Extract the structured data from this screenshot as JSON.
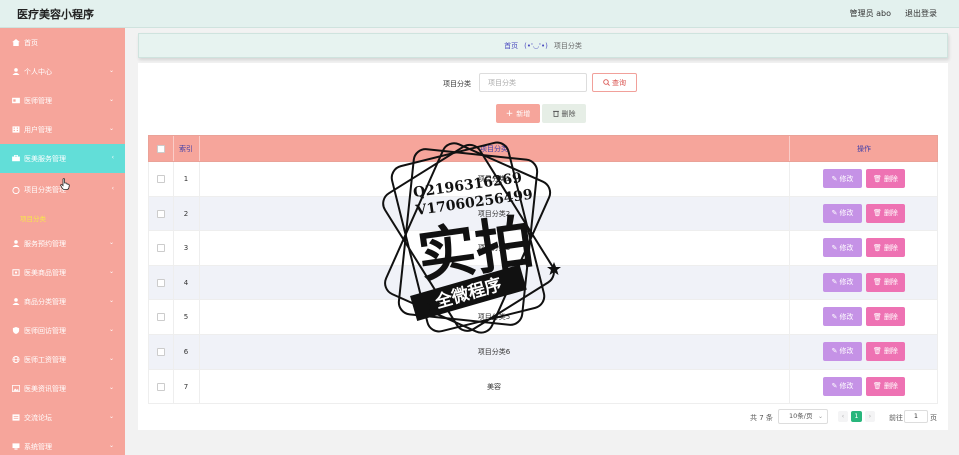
{
  "app": {
    "title": "医疗美容小程序"
  },
  "topbar": {
    "user": "管理员 abo",
    "logout": "退出登录"
  },
  "sidebar": {
    "items": [
      {
        "label": "首页",
        "icon": "home-icon",
        "chev": ""
      },
      {
        "label": "个人中心",
        "icon": "user-icon",
        "chev": "⌄"
      },
      {
        "label": "医师管理",
        "icon": "id-card-icon",
        "chev": "⌄"
      },
      {
        "label": "用户管理",
        "icon": "building-icon",
        "chev": "⌄"
      },
      {
        "label": "医美服务管理",
        "icon": "service-icon",
        "chev": "‹"
      },
      {
        "label": "项目分类管理",
        "icon": "chat-icon",
        "chev": "‹"
      },
      {
        "label": "服务预约管理",
        "icon": "user-icon",
        "chev": "⌄"
      },
      {
        "label": "医美商品管理",
        "icon": "goods-icon",
        "chev": "⌄"
      },
      {
        "label": "商品分类管理",
        "icon": "user-icon",
        "chev": "⌄"
      },
      {
        "label": "医师回访管理",
        "icon": "shield-icon",
        "chev": "⌄"
      },
      {
        "label": "医师工资管理",
        "icon": "globe-icon",
        "chev": "⌄"
      },
      {
        "label": "医美资讯管理",
        "icon": "image-icon",
        "chev": "⌄"
      },
      {
        "label": "交流论坛",
        "icon": "forum-icon",
        "chev": "⌄"
      },
      {
        "label": "系统管理",
        "icon": "system-icon",
        "chev": "⌄"
      }
    ],
    "submenu": {
      "label": "项目分类"
    }
  },
  "breadcrumb": {
    "home": "首页",
    "emoticon": "(•'◡'•)",
    "current": "项目分类"
  },
  "search": {
    "label": "项目分类",
    "placeholder": "项目分类",
    "query_label": "查询"
  },
  "toolbar": {
    "add_label": "新增",
    "delete_label": "删除"
  },
  "table": {
    "headers": {
      "index": "索引",
      "name": "项目分类",
      "ops": "操作"
    },
    "rows": [
      {
        "index": "1",
        "name": "项目分类1"
      },
      {
        "index": "2",
        "name": "项目分类2"
      },
      {
        "index": "3",
        "name": "项目分类3"
      },
      {
        "index": "4",
        "name": "项目分类4"
      },
      {
        "index": "5",
        "name": "项目分类5"
      },
      {
        "index": "6",
        "name": "项目分类6"
      },
      {
        "index": "7",
        "name": "美容"
      }
    ],
    "edit_label": "修改",
    "delete_label": "删除"
  },
  "pager": {
    "total": "共 7 条",
    "size": "10条/页",
    "page": "1",
    "goto": "前往",
    "goto_value": "1",
    "unit": "页"
  },
  "watermark": {
    "line1": "Q2196316269",
    "line2": "V17060256499",
    "big": "实拍",
    "banner": "全微程序"
  },
  "colors": {
    "sidebar": "#f6a59b",
    "active": "#62ded8",
    "edit": "#c592e6",
    "delete": "#ee72b3",
    "page": "#28b67c"
  }
}
